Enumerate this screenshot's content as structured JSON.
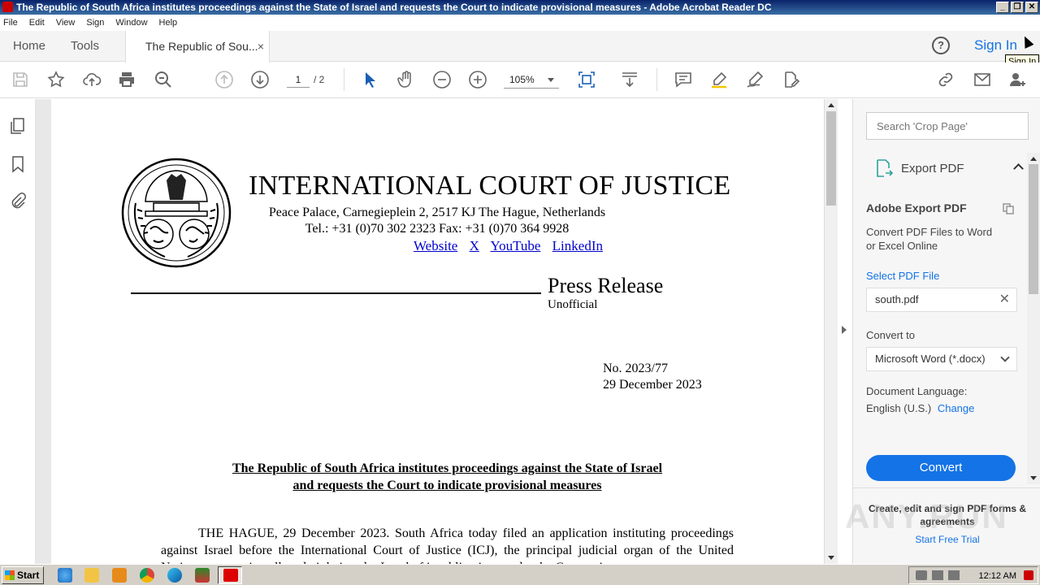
{
  "window": {
    "title": "The Republic of South Africa institutes proceedings against  the State of Israel and requests the Court to indicate provisional measures - Adobe Acrobat Reader DC",
    "minimize": "_",
    "maximize": "❐",
    "close": "✕"
  },
  "menu": [
    "File",
    "Edit",
    "View",
    "Sign",
    "Window",
    "Help"
  ],
  "tabs": {
    "home": "Home",
    "tools": "Tools",
    "document": "The Republic of Sou...",
    "close": "×"
  },
  "header": {
    "help": "?",
    "sign_in": "Sign In",
    "tooltip": "Sign In"
  },
  "toolbar": {
    "page_current": "1",
    "page_total": "/ 2",
    "zoom": "105%"
  },
  "document": {
    "court_name": "INTERNATIONAL COURT OF JUSTICE",
    "address": "Peace Palace, Carnegieplein 2, 2517 KJ  The Hague, Netherlands",
    "phone": "Tel.: +31 (0)70 302 2323   Fax: +31 (0)70 364 9928",
    "links": [
      "Website",
      "X",
      "YouTube",
      "LinkedIn"
    ],
    "press_release": "Press Release",
    "unofficial": "Unofficial",
    "number": "No. 2023/77",
    "date": "29 December 2023",
    "headline_1": "The Republic of South Africa institutes proceedings against the State of Israel",
    "headline_2": "and requests the Court to indicate provisional measures",
    "body": "THE HAGUE, 29 December 2023. South Africa today filed an application instituting proceedings against Israel before the International Court of Justice (ICJ), the principal judicial organ of the United Nations, concerning alleged violations by Israel of its obligations under the Convention"
  },
  "right_pane": {
    "search_placeholder": "Search 'Crop Page'",
    "export_label": "Export PDF",
    "heading": "Adobe Export PDF",
    "description": "Convert PDF Files to Word or Excel Online",
    "select_label": "Select PDF File",
    "file_name": "south.pdf",
    "convert_to_label": "Convert to",
    "convert_to_value": "Microsoft Word (*.docx)",
    "language_label": "Document Language:",
    "language_value": "English (U.S.)",
    "change": "Change",
    "convert_button": "Convert",
    "promo": "Create, edit and sign PDF forms & agreements",
    "trial": "Start Free Trial",
    "watermark": "ANY.RUN"
  },
  "taskbar": {
    "start": "Start",
    "clock": "12:12 AM"
  },
  "colors": {
    "accent": "#1473e6",
    "titlebar": "#0a246a",
    "link": "#0000cc"
  }
}
